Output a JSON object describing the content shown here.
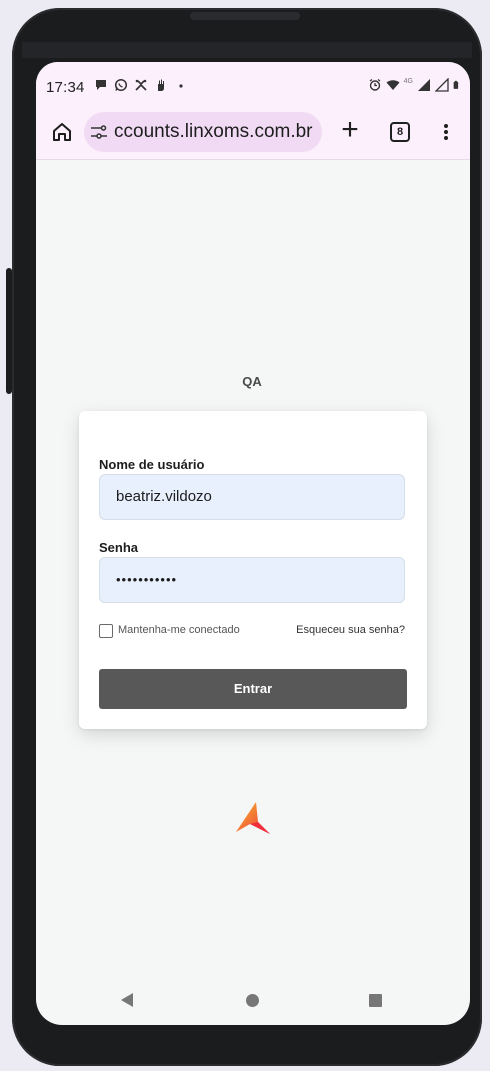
{
  "status_bar": {
    "time": "17:34",
    "left_icons": [
      "chat-bubble-icon",
      "whatsapp-icon",
      "tools-icon",
      "hand-icon",
      "dot-icon"
    ],
    "right_icons": [
      "alarm-icon",
      "wifi-icon",
      "4g-signal-icon",
      "signal-empty-icon",
      "battery-icon"
    ],
    "network_label": "4G"
  },
  "browser": {
    "url": "ccounts.linxoms.com.br",
    "tab_count": "8",
    "accent": "#fcf0fc",
    "urlbar_color": "#f1dbf4"
  },
  "page": {
    "brand": "QA",
    "login": {
      "username_label": "Nome de usuário",
      "username_value": "beatriz.vildozo",
      "password_label": "Senha",
      "password_value": "•••••••••••",
      "remember_label": "Mantenha-me conectado",
      "remember_checked": false,
      "forgot_label": "Esqueceu sua senha?",
      "submit_label": "Entrar",
      "button_color": "#585858",
      "field_color": "#e8f0fd"
    },
    "logo_colors": [
      "#f6b92f",
      "#ef2e3b"
    ]
  },
  "nav": {
    "items": [
      "back-icon",
      "home-circle-icon",
      "recents-square-icon"
    ]
  }
}
